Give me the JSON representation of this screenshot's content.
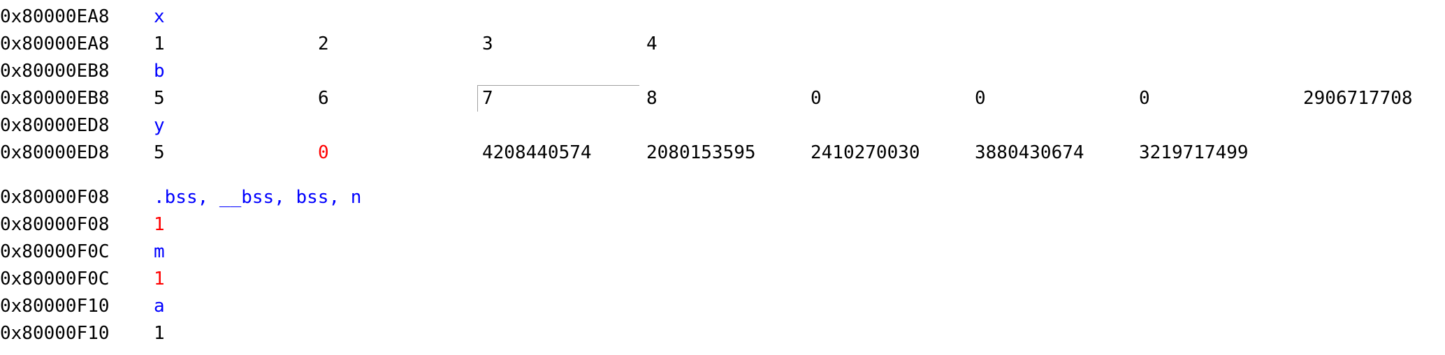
{
  "memory_view": {
    "rows": [
      {
        "addr": "0x80000EA8",
        "symbol": "x"
      },
      {
        "addr": "0x80000EA8",
        "cells": [
          "1",
          "2",
          "3",
          "4"
        ]
      },
      {
        "addr": "0x80000EB8",
        "symbol": "b"
      },
      {
        "addr": "0x80000EB8",
        "cells": [
          "5",
          "6",
          "7",
          "8",
          "0",
          "0",
          "0",
          "2906717708"
        ]
      },
      {
        "addr": "0x80000ED8",
        "symbol": "y"
      },
      {
        "addr": "0x80000ED8",
        "cells": [
          "5",
          "0",
          "4208440574",
          "2080153595",
          "2410270030",
          "3880430674",
          "3219717499"
        ]
      },
      {
        "addr": "0x80000F08",
        "symbol": ".bss, __bss, bss, n"
      },
      {
        "addr": "0x80000F08",
        "cells": [
          "1"
        ]
      },
      {
        "addr": "0x80000F0C",
        "symbol": "m"
      },
      {
        "addr": "0x80000F0C",
        "cells": [
          "1"
        ]
      },
      {
        "addr": "0x80000F10",
        "symbol": "a"
      },
      {
        "addr": "0x80000F10",
        "cells": [
          "1"
        ]
      }
    ]
  },
  "colors": {
    "symbol": "#0000ff",
    "changed_value": "#ff0000",
    "value": "#000000"
  }
}
